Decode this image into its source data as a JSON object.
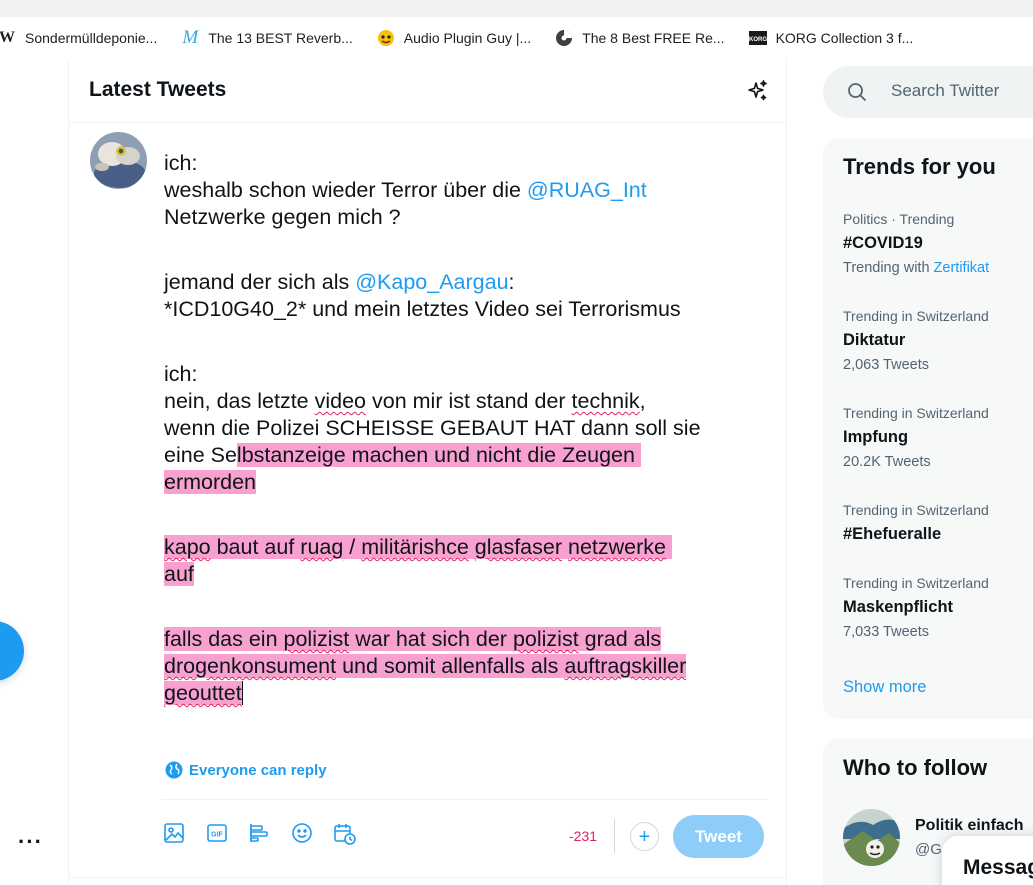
{
  "bookmarks": [
    {
      "icon": "wikipedia-icon",
      "label": "Sondermülldeponie..."
    },
    {
      "icon": "reverb-site-icon",
      "label": "The 13 BEST Reverb..."
    },
    {
      "icon": "plugin-guy-icon",
      "label": "Audio Plugin Guy |..."
    },
    {
      "icon": "disc-icon",
      "label": "The 8 Best FREE Re..."
    },
    {
      "icon": "korg-icon",
      "label": "KORG Collection 3 f..."
    }
  ],
  "main": {
    "title": "Latest Tweets",
    "compose": {
      "line1": "ich:",
      "line2_pre": "weshalb schon wieder Terror über die ",
      "line2_mention": "@RUAG_Int",
      "line3": "Netzwerke gegen mich ?",
      "line4_pre": "jemand der sich als ",
      "line4_mention": "@Kapo_Aargau",
      "line4_post": ":",
      "line5": "*ICD10G40_2* und mein letztes Video sei Terrorismus",
      "line6": "ich:",
      "line7_a": "nein, das letzte ",
      "line7_b": "video",
      "line7_c": " von mir ist stand der ",
      "line7_d": "technik",
      "line7_e": ",",
      "line8": "wenn die Polizei SCHEISSE GEBAUT HAT dann soll sie",
      "line9_pre": "eine Se",
      "line9_hl": "lbstanzeige machen und nicht die Zeugen ",
      "line10": "ermorden",
      "line11_a": "kapo",
      "line11_b": " baut auf ",
      "line11_c": "ruag",
      "line11_d": " / ",
      "line11_e": "militärishce",
      "line11_f": " ",
      "line11_g": "glasfaser",
      "line11_h": " ",
      "line11_i": "netzwerke",
      "line11_j": " ",
      "line12": "auf",
      "line13_a": "falls das ein ",
      "line13_b": "polizist",
      "line13_c": " war hat sich der ",
      "line13_d": "polizist",
      "line13_e": " grad als",
      "line14_a": "drogenkonsument",
      "line14_b": " und somit allenfalls als ",
      "line14_c": "auftragskiller",
      "line15": "geouttet"
    },
    "reply_setting": "Everyone can reply",
    "toolbar_icons": [
      "image-icon",
      "gif-icon",
      "poll-icon",
      "emoji-icon",
      "schedule-icon"
    ],
    "char_counter": "-231",
    "tweet_button": "Tweet",
    "add_button": "+"
  },
  "sidebar": {
    "search_placeholder": "Search Twitter",
    "trends_title": "Trends for you",
    "trends": [
      {
        "context": "Politics · Trending",
        "name": "#COVID19",
        "meta_pre": "Trending with ",
        "meta_link": "Zertifikat"
      },
      {
        "context": "Trending in Switzerland",
        "name": "Diktatur",
        "meta_pre": "2,063 Tweets",
        "meta_link": ""
      },
      {
        "context": "Trending in Switzerland",
        "name": "Impfung",
        "meta_pre": "20.2K Tweets",
        "meta_link": ""
      },
      {
        "context": "Trending in Switzerland",
        "name": "#Ehefueralle",
        "meta_pre": "",
        "meta_link": ""
      },
      {
        "context": "Trending in Switzerland",
        "name": "Maskenpflicht",
        "meta_pre": "7,033 Tweets",
        "meta_link": ""
      }
    ],
    "show_more": "Show more",
    "who_to_follow_title": "Who to follow",
    "follow_suggestion": {
      "name": "Politik einfach",
      "handle": "@G"
    },
    "messages_label": "Messages"
  },
  "colors": {
    "accent": "#1d9bf0",
    "highlight": "#f8a1d1",
    "counter_negative": "#e0245e",
    "tweet_button_disabled": "#8ecdf8"
  }
}
